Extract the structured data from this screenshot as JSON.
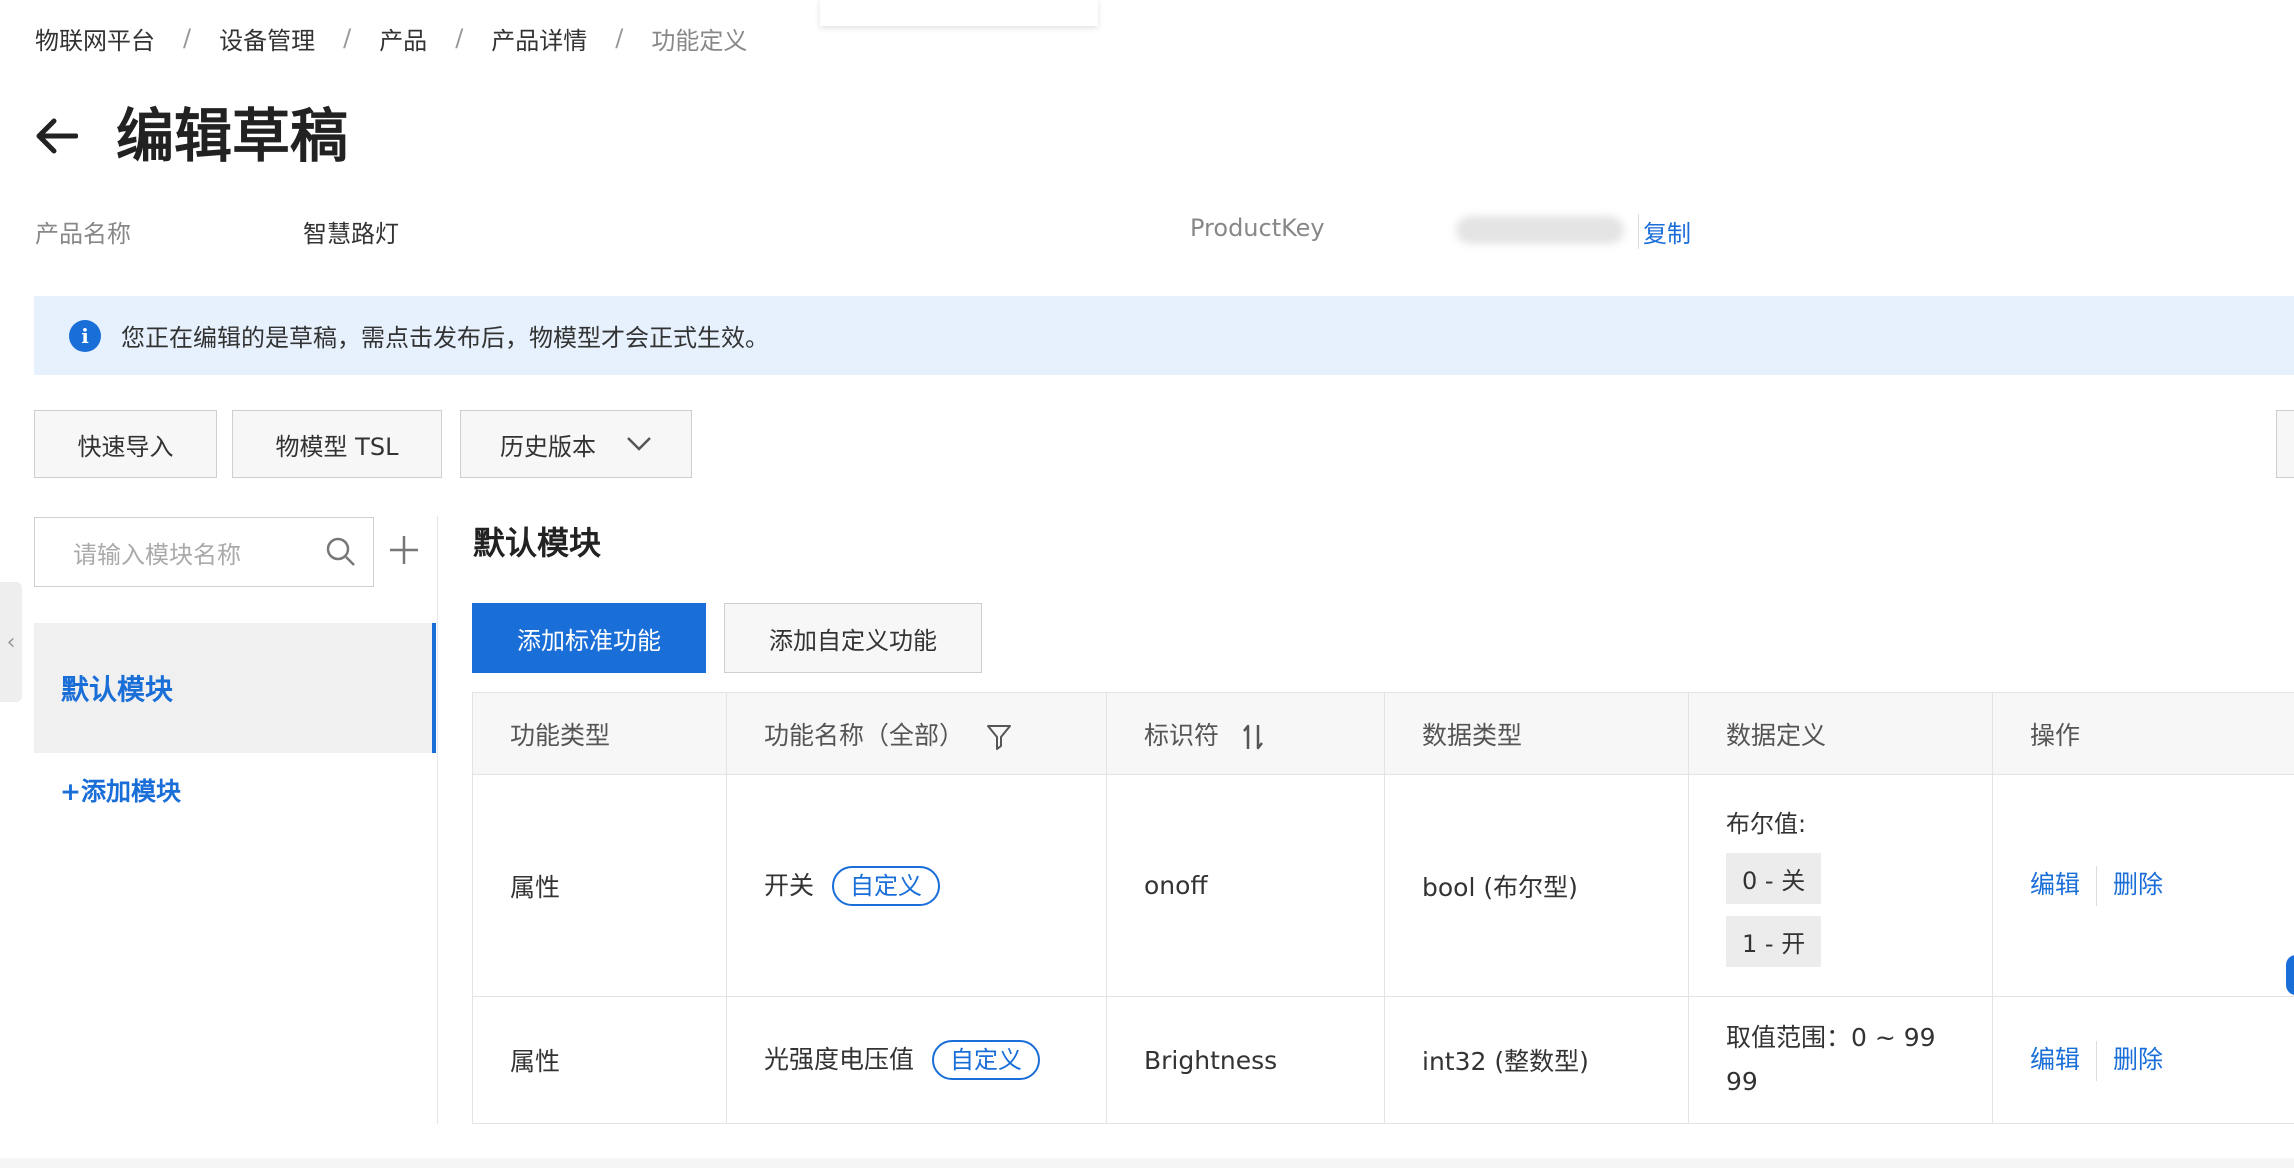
{
  "breadcrumb": [
    "物联网平台",
    "设备管理",
    "产品",
    "产品详情",
    "功能定义"
  ],
  "breadcrumb_sep": "/",
  "page_title": "编辑草稿",
  "meta": {
    "product_name_label": "产品名称",
    "product_name_value": "智慧路灯",
    "product_key_label": "ProductKey",
    "copy_label": "复制"
  },
  "alert": {
    "text": "您正在编辑的是草稿，需点击发布后，物模型才会正式生效。",
    "icon": "info-icon"
  },
  "toolbar": {
    "quick_import": "快速导入",
    "tsl": "物模型 TSL",
    "history": "历史版本"
  },
  "sidebar": {
    "search_placeholder": "请输入模块名称",
    "modules": [
      "默认模块"
    ],
    "add_module": "+添加模块"
  },
  "main": {
    "section_title": "默认模块",
    "add_standard": "添加标准功能",
    "add_custom": "添加自定义功能"
  },
  "table": {
    "headers": [
      "功能类型",
      "功能名称（全部）",
      "标识符",
      "数据类型",
      "数据定义",
      "操作"
    ],
    "rows": [
      {
        "type": "属性",
        "name": "开关",
        "tag": "自定义",
        "identifier": "onoff",
        "data_type": "bool (布尔型)",
        "def_label": "布尔值:",
        "def_items": [
          "0 - 关",
          "1 - 开"
        ],
        "edit": "编辑",
        "delete": "删除"
      },
      {
        "type": "属性",
        "name": "光强度电压值",
        "tag": "自定义",
        "identifier": "Brightness",
        "data_type": "int32 (整数型)",
        "def_range_line1": "取值范围：0 ~ 99",
        "def_range_line2": "99",
        "edit": "编辑",
        "delete": "删除"
      }
    ]
  },
  "colors": {
    "accent": "#1a6ed8",
    "alert_bg": "#e6f1fd",
    "header_bg": "#f7f7f7"
  }
}
